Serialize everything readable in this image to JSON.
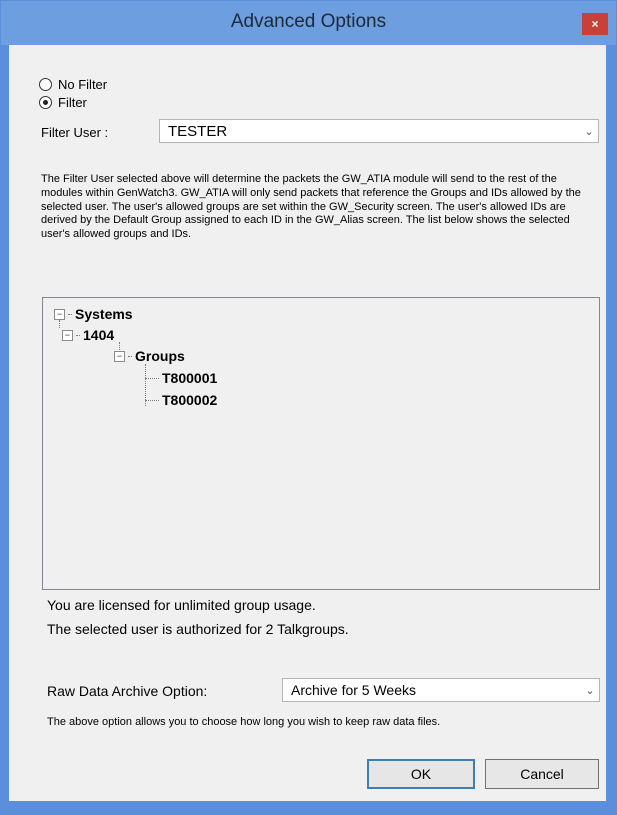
{
  "window": {
    "title": "Advanced Options",
    "close_glyph": "×"
  },
  "filter_mode": {
    "options": [
      {
        "label": "No Filter",
        "checked": false
      },
      {
        "label": "Filter",
        "checked": true
      }
    ]
  },
  "filter_user": {
    "label": "Filter User :",
    "value": "TESTER"
  },
  "description": "The Filter User selected above will determine the packets the GW_ATIA module will send to the rest of the modules within GenWatch3.  GW_ATIA will only send packets that reference the Groups and IDs allowed by the selected user.  The user's allowed groups are set within the GW_Security screen.  The user's allowed IDs are derived by the Default Group assigned to each ID in the GW_Alias screen.  The list below shows the selected user's allowed groups and IDs.",
  "tree": {
    "root": "Systems",
    "system": "1404",
    "groups_label": "Groups",
    "groups": [
      "T800001",
      "T800002"
    ],
    "expander_glyph": "−"
  },
  "license_status": "You are licensed for unlimited group usage.",
  "auth_status": "The selected user is authorized for 2 Talkgroups.",
  "archive": {
    "label": "Raw Data Archive Option:",
    "value": "Archive for 5 Weeks",
    "note": "The above option allows you to choose how long you wish to keep raw data files."
  },
  "buttons": {
    "ok": "OK",
    "cancel": "Cancel"
  },
  "dropdown_glyph": "⌄",
  "colors": {
    "titlebar": "#6c9ee0",
    "close": "#c7403a",
    "client": "#f0f0f0"
  }
}
